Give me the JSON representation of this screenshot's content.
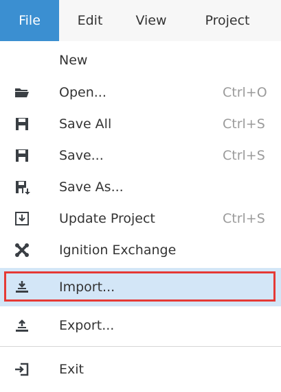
{
  "menubar": {
    "items": [
      {
        "label": "File",
        "active": true
      },
      {
        "label": "Edit"
      },
      {
        "label": "View"
      },
      {
        "label": "Project"
      }
    ]
  },
  "file_menu": {
    "items": [
      {
        "label": "New",
        "shortcut": "",
        "icon": "none"
      },
      {
        "label": "Open...",
        "shortcut": "Ctrl+O",
        "icon": "folder-open-icon"
      },
      {
        "label": "Save All",
        "shortcut": "Ctrl+S",
        "icon": "save-all-icon"
      },
      {
        "label": "Save...",
        "shortcut": "Ctrl+S",
        "icon": "save-icon"
      },
      {
        "label": "Save As...",
        "shortcut": "",
        "icon": "save-as-icon"
      },
      {
        "label": "Update Project",
        "shortcut": "Ctrl+S",
        "icon": "update-project-icon"
      },
      {
        "label": "Ignition Exchange",
        "shortcut": "",
        "icon": "ignition-exchange-icon"
      },
      {
        "label": "Import...",
        "shortcut": "",
        "icon": "import-icon",
        "highlighted": true
      },
      {
        "label": "Export...",
        "shortcut": "",
        "icon": "export-icon"
      },
      {
        "label": "Exit",
        "shortcut": "",
        "icon": "exit-icon"
      }
    ]
  },
  "colors": {
    "active_menu": "#3b8fd1",
    "highlight_bg": "#d3e6f7",
    "highlight_border": "#e53935",
    "icon": "#3a3f44"
  }
}
